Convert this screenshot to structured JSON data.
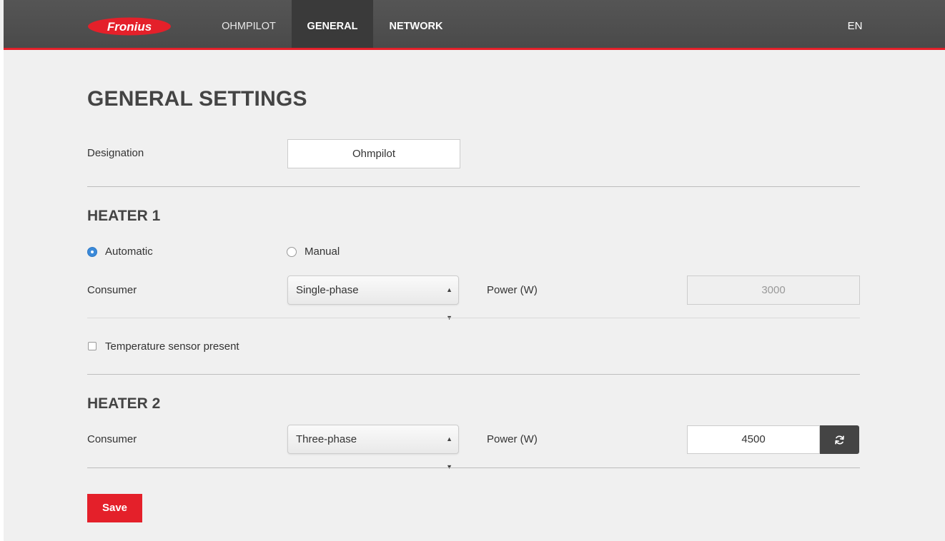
{
  "header": {
    "logo_text": "Fronius",
    "tabs": [
      {
        "label": "OHMPILOT"
      },
      {
        "label": "GENERAL"
      },
      {
        "label": "NETWORK"
      }
    ],
    "language": "EN"
  },
  "page_title": "GENERAL SETTINGS",
  "designation": {
    "label": "Designation",
    "value": "Ohmpilot"
  },
  "heater1": {
    "title": "HEATER 1",
    "mode_automatic": "Automatic",
    "mode_manual": "Manual",
    "selected_mode": "Automatic",
    "consumer_label": "Consumer",
    "consumer_value": "Single-phase",
    "power_label": "Power (W)",
    "power_value": "3000",
    "temp_sensor_label": "Temperature sensor present",
    "temp_sensor_checked": false
  },
  "heater2": {
    "title": "HEATER 2",
    "consumer_label": "Consumer",
    "consumer_value": "Three-phase",
    "power_label": "Power (W)",
    "power_value": "4500"
  },
  "save_label": "Save",
  "colors": {
    "accent": "#e4202a",
    "radio": "#3b8ad9",
    "topbar": "#4a4a4a"
  },
  "icons": [
    "fronius-logo",
    "refresh-icon",
    "select-caret-icon"
  ]
}
